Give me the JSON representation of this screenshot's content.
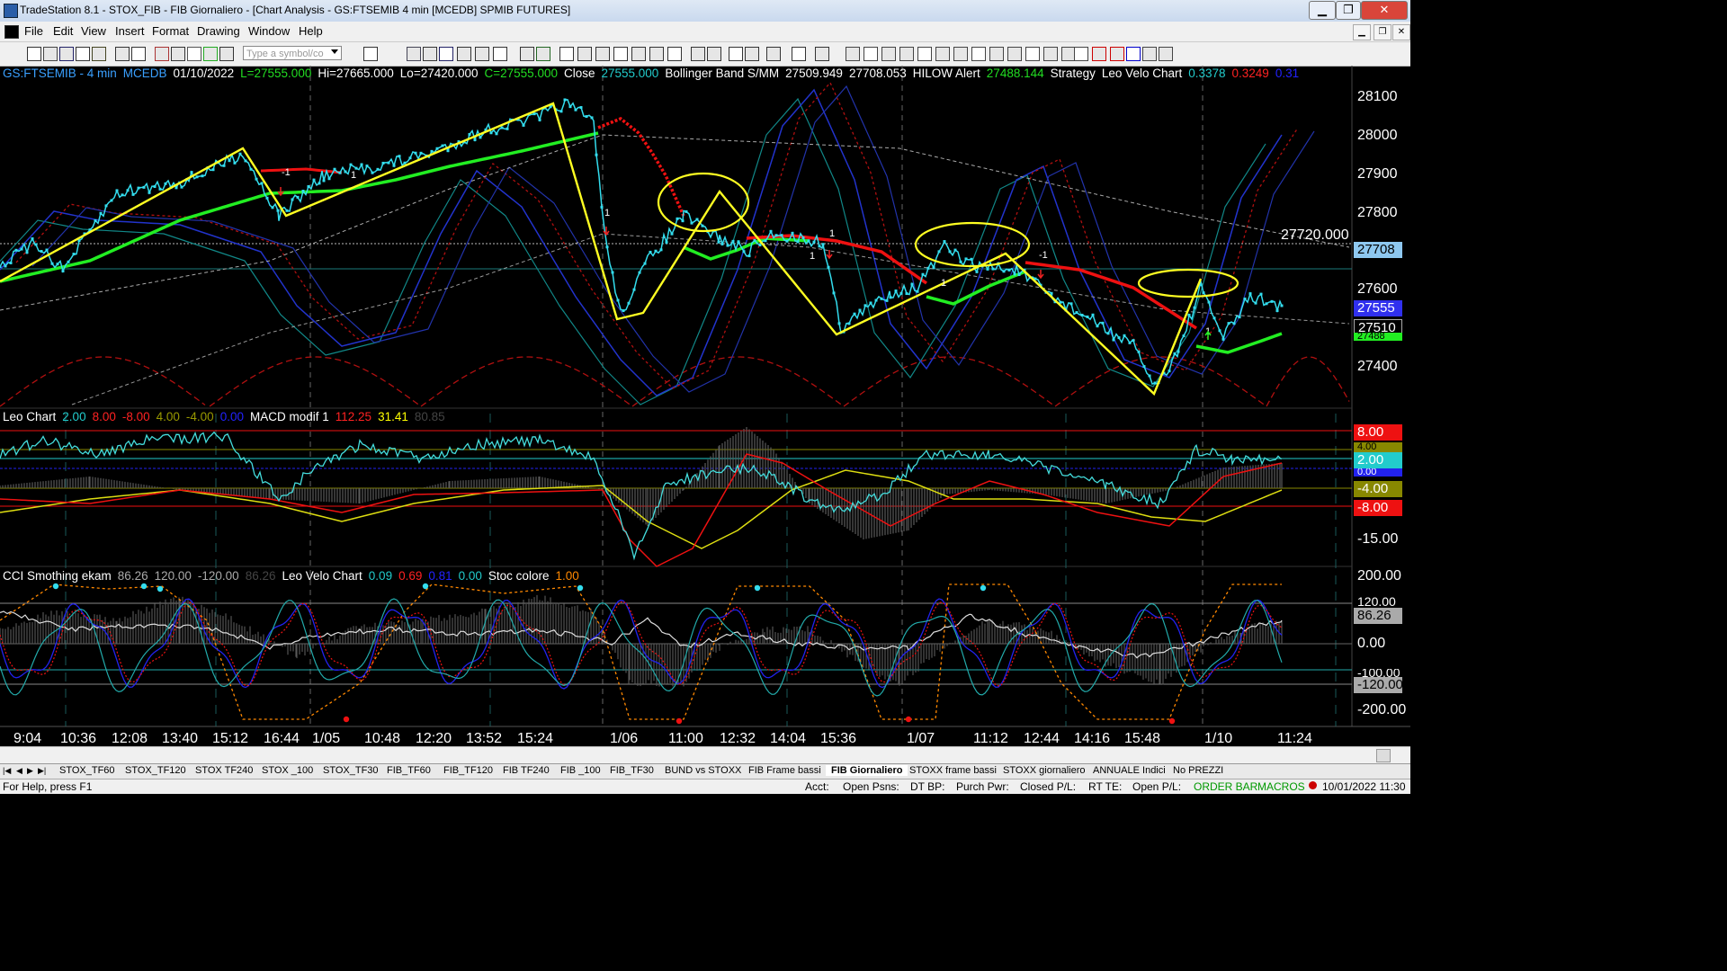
{
  "window": {
    "title": "TradeStation 8.1 - STOX_FIB - FIB Giornaliero - [Chart Analysis - GS:FTSEMIB  4 min  [MCEDB] SPMIB FUTURES]"
  },
  "menu": [
    "File",
    "Edit",
    "View",
    "Insert",
    "Format",
    "Drawing",
    "Window",
    "Help"
  ],
  "toolbar": {
    "symbol_placeholder": "Type a symbol/co"
  },
  "chart": {
    "main_legend": [
      {
        "text": "GS:FTSEMIB - 4 min",
        "color": "#3aa0ff"
      },
      {
        "text": "MCEDB",
        "color": "#3aa0ff"
      },
      {
        "text": "01/10/2022",
        "color": "#ffffff"
      },
      {
        "text": "L=27555.000",
        "color": "#22dd22"
      },
      {
        "text": "Hi=27665.000",
        "color": "#ffffff"
      },
      {
        "text": "Lo=27420.000",
        "color": "#ffffff"
      },
      {
        "text": "C=27555.000",
        "color": "#22dd22"
      },
      {
        "text": "Close",
        "color": "#ffffff"
      },
      {
        "text": "27555.000",
        "color": "#22cccc"
      },
      {
        "text": "Bollinger Band S/MM",
        "color": "#ffffff"
      },
      {
        "text": "27509.949",
        "color": "#ffffff"
      },
      {
        "text": "27708.053",
        "color": "#ffffff"
      },
      {
        "text": "HILOW Alert",
        "color": "#ffffff"
      },
      {
        "text": "27488.144",
        "color": "#22dd22"
      },
      {
        "text": "Strategy",
        "color": "#ffffff"
      },
      {
        "text": "Leo Velo Chart",
        "color": "#ffffff"
      },
      {
        "text": "0.3378",
        "color": "#22cccc"
      },
      {
        "text": "0.3249",
        "color": "#ff2222"
      },
      {
        "text": "0.31",
        "color": "#2222ff"
      }
    ],
    "leo_legend": [
      {
        "text": "Leo Chart",
        "color": "#ffffff"
      },
      {
        "text": "2.00",
        "color": "#22cccc"
      },
      {
        "text": "8.00",
        "color": "#ff2222"
      },
      {
        "text": "-8.00",
        "color": "#ff2222"
      },
      {
        "text": "4.00",
        "color": "#999900"
      },
      {
        "text": "-4.00",
        "color": "#999900"
      },
      {
        "text": "0.00",
        "color": "#2222ff"
      },
      {
        "text": "MACD modif 1",
        "color": "#ffffff"
      },
      {
        "text": "112.25",
        "color": "#ff2222"
      },
      {
        "text": "31.41",
        "color": "#ffff00"
      },
      {
        "text": "80.85",
        "color": "#444444"
      }
    ],
    "cci_legend": [
      {
        "text": "CCI Smothing ekam",
        "color": "#ffffff"
      },
      {
        "text": "86.26",
        "color": "#aaaaaa"
      },
      {
        "text": "120.00",
        "color": "#aaaaaa"
      },
      {
        "text": "-120.00",
        "color": "#aaaaaa"
      },
      {
        "text": "86.26",
        "color": "#444444"
      },
      {
        "text": "Leo Velo Chart",
        "color": "#ffffff"
      },
      {
        "text": "0.09",
        "color": "#22cccc"
      },
      {
        "text": "0.69",
        "color": "#ff2222"
      },
      {
        "text": "0.81",
        "color": "#2222ff"
      },
      {
        "text": "0.00",
        "color": "#22cccc"
      },
      {
        "text": "Stoc colore",
        "color": "#ffffff"
      },
      {
        "text": "1.00",
        "color": "#ff8800"
      }
    ],
    "price_axis": [
      "28100",
      "28000",
      "27900",
      "27800",
      "27600",
      "27400"
    ],
    "price_tags": {
      "hline": "27720.000",
      "t27708": "27708",
      "t27555": "27555",
      "t27510": "27510",
      "t27488": "27488"
    },
    "osc_axis": {
      "v8": "8.00",
      "v4": "4.00",
      "v2": "2.00",
      "v0": "0.00",
      "vm4": "-4.00",
      "vm8": "-8.00",
      "vm15": "-15.00"
    },
    "cci_axis": {
      "v200": "200.00",
      "v120": "120.00",
      "v86": "86.26",
      "v0": "0.00",
      "vm100": "-100.00",
      "vm120": "-120.00",
      "vm200": "-200.00"
    },
    "strategy_labels": {
      "one": "1",
      "minus_one": "-1"
    },
    "x_labels": [
      "9:04",
      "10:36",
      "12:08",
      "13:40",
      "15:12",
      "16:44",
      "1/05",
      "10:48",
      "12:20",
      "13:52",
      "15:24",
      "1/06",
      "11:00",
      "12:32",
      "14:04",
      "15:36",
      "1/07",
      "11:12",
      "12:44",
      "14:16",
      "15:48",
      "1/10",
      "11:24"
    ]
  },
  "tabs": [
    "STOX_TF60",
    "STOX_TF120",
    "STOX TF240",
    "STOX _100",
    "STOX_TF30",
    "FIB_TF60",
    "FIB_TF120",
    "FIB TF240",
    "FIB _100",
    "FIB_TF30",
    "BUND vs STOXX",
    "FIB Frame bassi",
    "FIB Giornaliero",
    "STOXX frame bassi",
    "STOXX giornaliero",
    "ANNUALE Indici",
    "No PREZZI"
  ],
  "active_tab": "FIB Giornaliero",
  "status": {
    "help": "For Help, press F1",
    "acct": "Acct:",
    "open_psns": "Open Psns:",
    "dt_bp": "DT BP:",
    "purch_pwr": "Purch Pwr:",
    "closed_pl": "Closed P/L:",
    "rt_te": "RT TE:",
    "open_pl": "Open P/L:",
    "order_bar": "ORDER BAR",
    "macros": "MACROS",
    "datetime": "10/01/2022 11:30"
  },
  "colors": {
    "background": "#000000",
    "price": "#33ddee",
    "ma_green": "#22ee22",
    "ma_red": "#ee1111",
    "zigzag": "#ffff22",
    "band_blue": "#2233cc",
    "band_teal": "#118888",
    "status_green": "#009900"
  }
}
